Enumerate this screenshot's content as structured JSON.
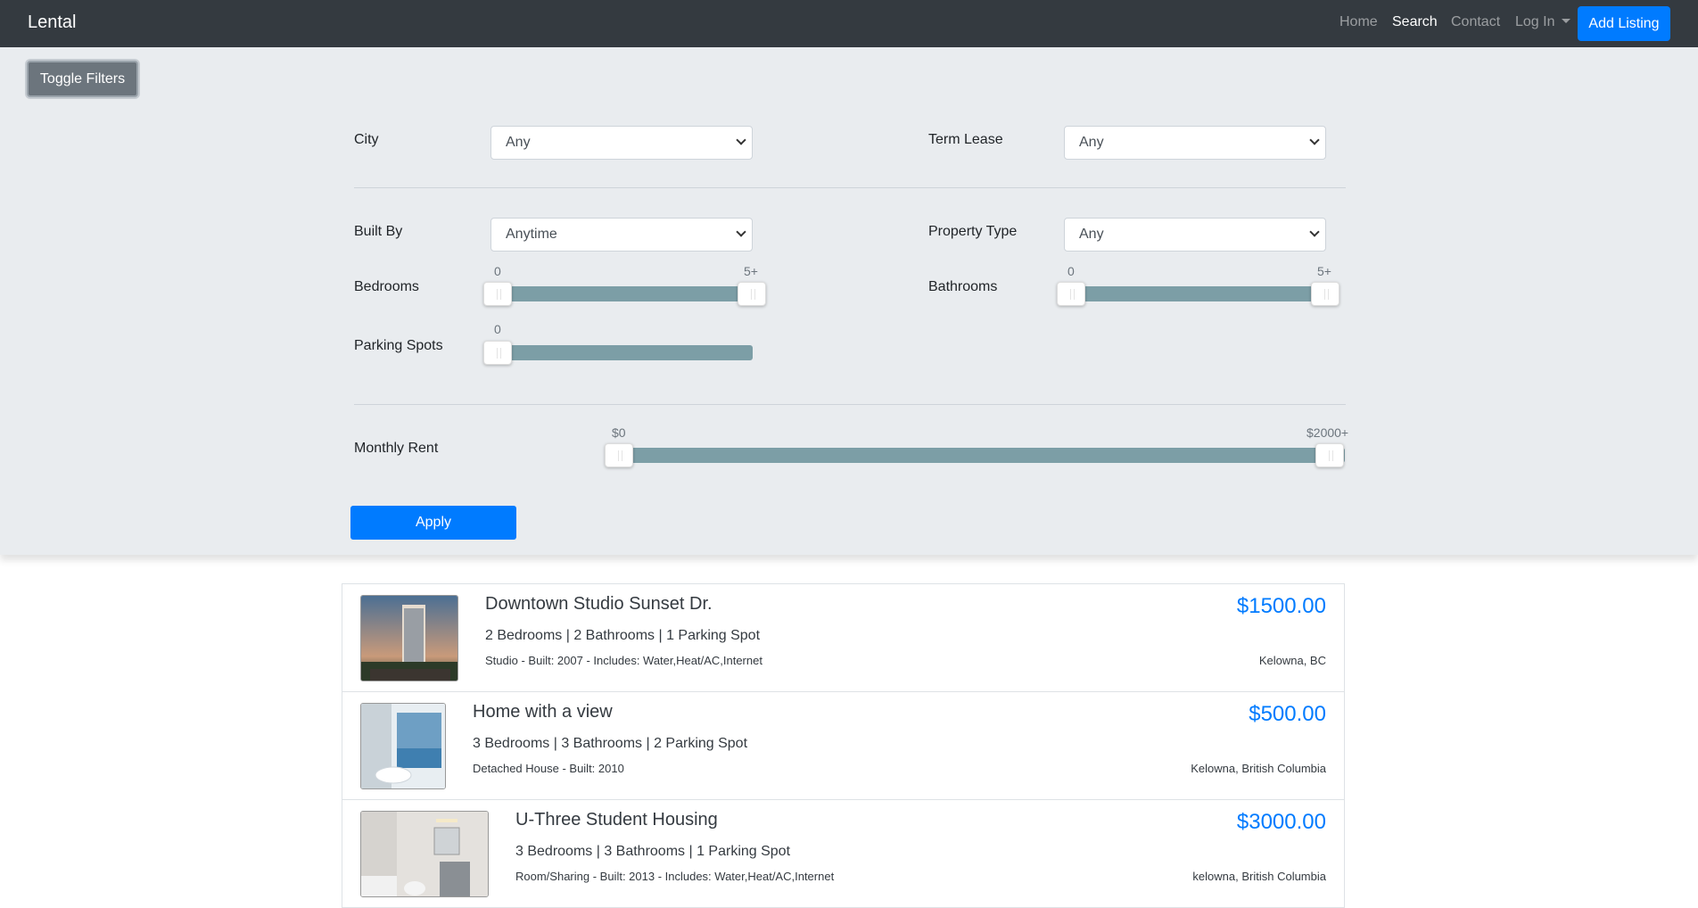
{
  "nav": {
    "brand": "Lental",
    "links": [
      "Home",
      "Search",
      "Contact"
    ],
    "login": "Log In",
    "add_listing": "Add Listing"
  },
  "filters": {
    "toggle_label": "Toggle Filters",
    "city": {
      "label": "City",
      "value": "Any"
    },
    "term_lease": {
      "label": "Term Lease",
      "value": "Any"
    },
    "built_by": {
      "label": "Built By",
      "value": "Anytime"
    },
    "property_type": {
      "label": "Property Type",
      "value": "Any"
    },
    "bedrooms": {
      "label": "Bedrooms",
      "min_label": "0",
      "max_label": "5+",
      "range": [
        0,
        5
      ]
    },
    "bathrooms": {
      "label": "Bathrooms",
      "min_label": "0",
      "max_label": "5+",
      "range": [
        0,
        5
      ]
    },
    "parking": {
      "label": "Parking Spots",
      "min_label": "0",
      "value": 0
    },
    "rent": {
      "label": "Monthly Rent",
      "min_label": "$0",
      "max_label": "$2000+",
      "range": [
        0,
        2000
      ]
    },
    "apply_label": "Apply"
  },
  "listings": [
    {
      "title": "Downtown Studio Sunset Dr.",
      "specs": "2 Bedrooms | 2 Bathrooms | 1 Parking Spot",
      "details": "Studio - Built: 2007 - Includes: Water,Heat/AC,Internet",
      "price": "$1500.00",
      "location": "Kelowna, BC",
      "thumb": "tower-photo"
    },
    {
      "title": "Home with a view",
      "specs": "3 Bedrooms | 3 Bathrooms | 2 Parking Spot",
      "details": "Detached House - Built: 2010",
      "price": "$500.00",
      "location": "Kelowna, British Columbia",
      "thumb": "bathroom-view-photo"
    },
    {
      "title": "U-Three Student Housing",
      "specs": "3 Bedrooms | 3 Bathrooms | 1 Parking Spot",
      "details": "Room/Sharing - Built: 2013 - Includes: Water,Heat/AC,Internet",
      "price": "$3000.00",
      "location": "kelowna, British Columbia",
      "thumb": "bathroom-photo"
    }
  ],
  "colors": {
    "navbar": "#343a40",
    "primary": "#007bff",
    "panel": "#e9ecef",
    "slider": "#7c9ea6"
  }
}
